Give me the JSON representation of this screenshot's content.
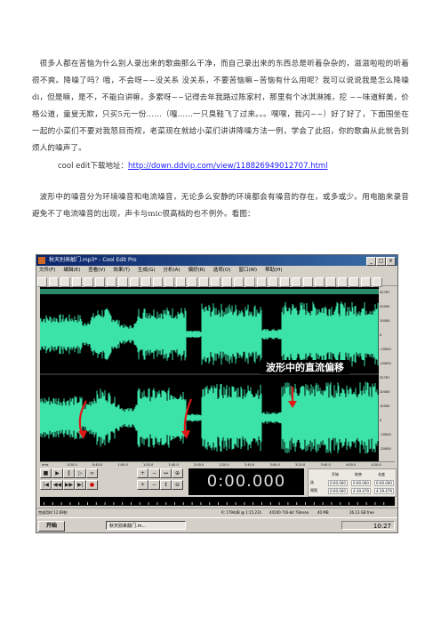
{
  "paragraph_1": "很多人都在苦恼为什么别人录出来的歌曲那么干净，而自己录出来的东西总是听着杂杂的，滋滋啦啦的听着很不爽。降噪了吗？哦，不会呀~~没关系 没关系，不要苦恼嘛~苦恼有什么用呢？我可以说说我是怎么降噪di，但是嘛，是不，不能白讲嘛，多累呀~~记得去年我路过陈家村，那里有个冰淇淋摊，挖 ~~味道鲜美，价格公道，童叟无欺，只买5元一份……（嘎……一只臭鞋飞了过来。。。嘿嘿，我闪~~）好了好了，下面围坐在一起的小菜们不要对我怒目而视，老菜现在就给小菜们讲讲降噪方法一例，学会了此招，你的歌曲从此就告别烦人的噪声了。",
  "download_label": "cool edit下载地址：",
  "download_url": "http://down.ddvip.com/view/118826949012707.html",
  "paragraph_2": "波形中的噪音分为环境噪音和电流噪音，无论多么安静的环境都会有噪音的存在，或多或少。用电脑来录音避免不了电流噪音的出现，声卡与mic很高档的也不例外。看图：",
  "screenshot": {
    "title": "秋天别来敲门.mp3* - Cool Edit Pro",
    "menu": [
      "文件(F)",
      "编辑(E)",
      "查看(V)",
      "效果(T)",
      "生成(G)",
      "分析(A)",
      "偏好(R)",
      "选项(O)",
      "窗口(W)",
      "帮助(H)"
    ],
    "annotation": "波形中的直流偏移",
    "time_display": "0:00.000",
    "status_left": "完成用时 12.69秒",
    "status_right": [
      "R: 1794dB @ 1:15.231",
      "44100 ?16-bit ?Stereo",
      "40 MB",
      "26.13 GB free"
    ],
    "start_label": "开始",
    "task_label": "秋天别来敲门.m...",
    "clock": "10:27",
    "selection_headers": [
      "开始",
      "结束",
      "长度"
    ],
    "selection_rows": [
      {
        "label": "选",
        "values": [
          "0:00.000",
          "0:00.000",
          "0:00.000"
        ]
      },
      {
        "label": "视图",
        "values": [
          "0:00.000",
          "4:39.479",
          "4:39.479"
        ]
      }
    ],
    "ruler_labels": [
      "32767",
      "20000",
      "10000",
      "0",
      "-10000",
      "-20000",
      "32767",
      "20000",
      "10000",
      "0",
      "-10000",
      "-20000"
    ],
    "timeline_labels": [
      "hms",
      "0:20.0",
      "0:40.0",
      "1:00.0",
      "1:20.0",
      "1:40.0",
      "2:00.0",
      "2:20.0",
      "2:40.0",
      "3:00.0",
      "3:20.0",
      "3:40.0",
      "4:00.0",
      "4:20.0"
    ],
    "colors": {
      "waveform": "#3be3a8",
      "background": "#000000",
      "arrow": "#e01818",
      "annotation_text": "#ffffff"
    }
  }
}
